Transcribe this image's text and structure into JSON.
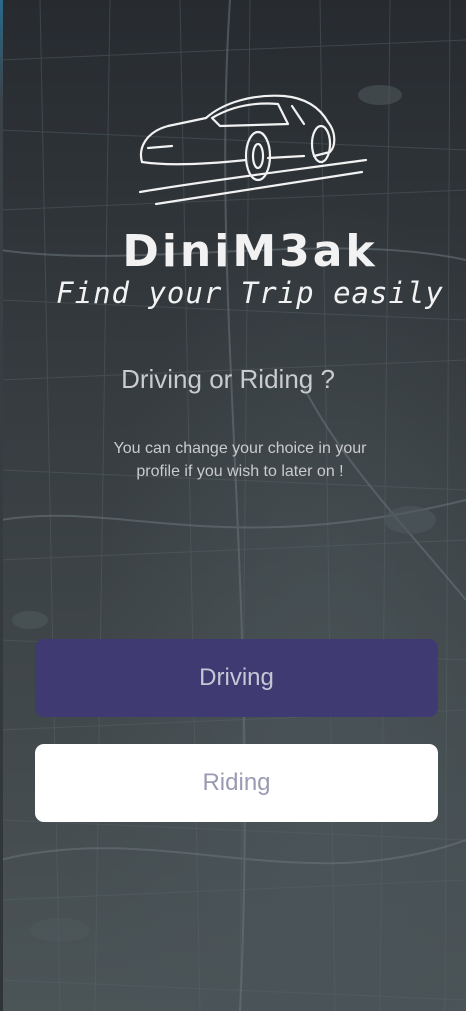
{
  "brand": {
    "name": "DiniM3ak",
    "tagline": "Find your Trip easily",
    "logo_icon": "car-icon"
  },
  "prompt": {
    "question": "Driving or Riding ?",
    "hint": "You can change your choice in your profile if you wish to later on !"
  },
  "options": {
    "driving_label": "Driving",
    "riding_label": "Riding"
  },
  "colors": {
    "driving_button": "#3f3a71",
    "riding_button": "#ffffff",
    "background": "#33393c"
  }
}
